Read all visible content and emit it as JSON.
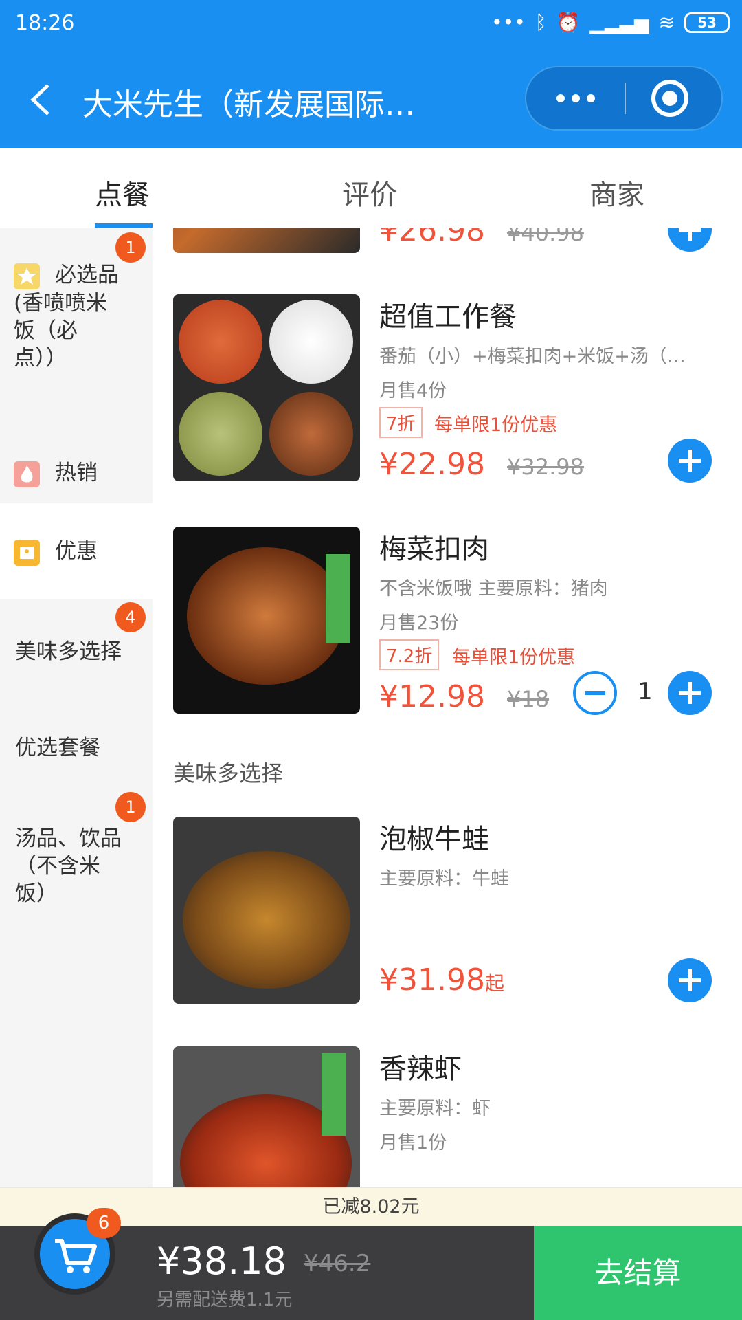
{
  "status_bar": {
    "time": "18:26",
    "battery": "53"
  },
  "navbar": {
    "title": "大米先生（新发展国际…"
  },
  "tabs": [
    "点餐",
    "评价",
    "商家"
  ],
  "sidebar": {
    "items": [
      {
        "label": "必选品(香喷喷米饭（必点）)",
        "line1": "必选品",
        "line2": "(香喷喷米",
        "line3": "饭（必",
        "line4": "点））",
        "badge": "1",
        "icon": "star-icon"
      },
      {
        "label": "热销",
        "icon": "flame-icon"
      },
      {
        "label": "优惠",
        "icon": "discount-icon"
      },
      {
        "label": "美味多选择",
        "badge": "4"
      },
      {
        "label": "优选套餐"
      },
      {
        "label": "汤品、饮品（不含米饭）",
        "line1": "汤品、饮品",
        "line2": "（不含米",
        "line3": "饭）",
        "badge": "1"
      }
    ]
  },
  "products": [
    {
      "price": "¥26.98",
      "old_price": "¥40.98"
    },
    {
      "name": "超值工作餐",
      "desc": "番茄（小）+梅菜扣肉+米饭+汤（…",
      "sold": "月售4份",
      "discount": "7折",
      "promo": "每单限1份优惠",
      "price": "¥22.98",
      "old_price": "¥32.98"
    },
    {
      "name": "梅菜扣肉",
      "desc": "不含米饭哦 主要原料：猪肉",
      "sold": "月售23份",
      "discount": "7.2折",
      "promo": "每单限1份优惠",
      "price": "¥12.98",
      "old_price": "¥18",
      "quantity": "1"
    },
    {
      "name": "泡椒牛蛙",
      "desc": "主要原料：牛蛙",
      "price": "¥31.98",
      "price_suffix": "起"
    },
    {
      "name": "香辣虾",
      "desc": "主要原料：虾",
      "sold": "月售1份"
    }
  ],
  "section_title": "美味多选择",
  "cart": {
    "discount_text": "已减8.02元",
    "badge": "6",
    "total": "¥38.18",
    "old_total": "¥46.2",
    "delivery": "另需配送费1.1元",
    "checkout": "去结算"
  },
  "colors": {
    "brand": "#1a8ff2",
    "price": "#f0523a",
    "checkout": "#2fc56e",
    "badge": "#f05a1f"
  }
}
